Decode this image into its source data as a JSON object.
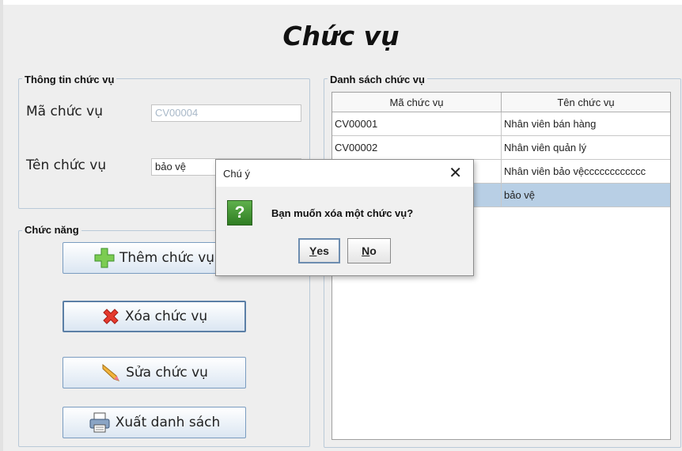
{
  "page": {
    "title": "Chức vụ"
  },
  "info_panel": {
    "title": "Thông tin chức vụ",
    "code_label": "Mã chức vụ",
    "code_value": "CV00004",
    "name_label": "Tên chức vụ",
    "name_value": "bảo vệ"
  },
  "functions_panel": {
    "title": "Chức năng",
    "buttons": [
      {
        "label": "Thêm chức vụ",
        "icon": "plus-icon"
      },
      {
        "label": "Xóa chức vụ",
        "icon": "delete-x-icon"
      },
      {
        "label": "Sửa chức vụ",
        "icon": "pencil-icon"
      },
      {
        "label": "Xuất danh sách",
        "icon": "printer-icon"
      }
    ]
  },
  "list_panel": {
    "title": "Danh sách chức vụ",
    "columns": [
      "Mã chức vụ",
      "Tên chức vụ"
    ],
    "rows": [
      [
        "CV00001",
        "Nhân viên bán hàng"
      ],
      [
        "CV00002",
        "Nhân viên quản lý"
      ],
      [
        "",
        "Nhân viên bảo vệcccccccccccc"
      ],
      [
        "",
        "bảo vệ"
      ]
    ],
    "selected_row": 3
  },
  "dialog": {
    "title": "Chú ý",
    "message": "Bạn muốn xóa một chức vụ?",
    "icon": "question-icon",
    "icon_glyph": "?",
    "yes_mnemonic": "Y",
    "yes_rest": "es",
    "no_mnemonic": "N",
    "no_rest": "o",
    "close_glyph": "✕"
  },
  "colors": {
    "selection": "#b8cfe5",
    "button_border": "#7a9cc0",
    "question_icon": "#3f8f30"
  }
}
